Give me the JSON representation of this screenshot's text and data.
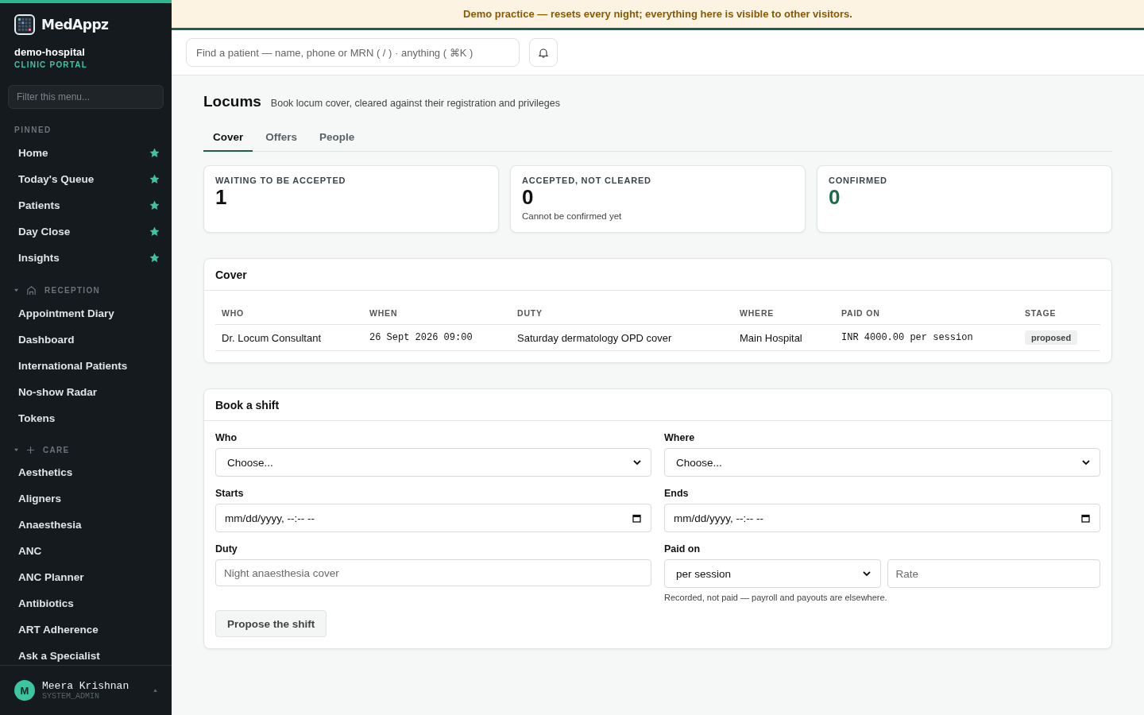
{
  "sidebar": {
    "brand": "MedAppz",
    "org": "demo-hospital",
    "portal": "CLINIC PORTAL",
    "filter": {
      "placeholder": "Filter this menu..."
    },
    "pinned": {
      "title": "PINNED",
      "items": [
        {
          "label": "Home",
          "starred": true
        },
        {
          "label": "Today's Queue",
          "starred": true
        },
        {
          "label": "Patients",
          "starred": true
        },
        {
          "label": "Day Close",
          "starred": true
        },
        {
          "label": "Insights",
          "starred": true
        }
      ]
    },
    "groups": [
      {
        "title": "RECEPTION",
        "kind": "house",
        "expanded": true,
        "items": [
          "Appointment Diary",
          "Dashboard",
          "International Patients",
          "No-show Radar",
          "Tokens"
        ]
      },
      {
        "title": "CARE",
        "kind": "plus",
        "expanded": true,
        "items": [
          "Aesthetics",
          "Aligners",
          "Anaesthesia",
          "ANC",
          "ANC Planner",
          "Antibiotics",
          "ART Adherence",
          "Ask a Specialist"
        ]
      }
    ],
    "user": {
      "initial": "M",
      "name": "Meera Krishnan",
      "role": "SYSTEM_ADMIN"
    }
  },
  "banner": "Demo practice — resets every night; everything here is visible to other visitors.",
  "search": {
    "placeholder": "Find a patient — name, phone or MRN ( / ) · anything ( ⌘K )"
  },
  "page": {
    "title": "Locums",
    "subtitle": "Book locum cover, cleared against their registration and privileges"
  },
  "tabs": [
    {
      "label": "Cover",
      "selected": true
    },
    {
      "label": "Offers",
      "selected": false
    },
    {
      "label": "People",
      "selected": false
    }
  ],
  "stats": [
    {
      "label": "WAITING TO BE ACCEPTED",
      "value": "1",
      "kind": "neutral"
    },
    {
      "label": "ACCEPTED, NOT CLEARED",
      "value": "0",
      "note": "Cannot be confirmed yet",
      "kind": "neutral"
    },
    {
      "label": "CONFIRMED",
      "value": "0",
      "kind": "positive"
    }
  ],
  "cover": {
    "title": "Cover",
    "columns": [
      "WHO",
      "WHEN",
      "DUTY",
      "WHERE",
      "PAID ON",
      "STAGE"
    ],
    "rows": [
      {
        "who": "Dr. Locum Consultant",
        "when": "26 Sept 2026 09:00",
        "duty": "Saturday dermatology OPD cover",
        "where": "Main Hospital",
        "paid": "INR 4000.00 per session",
        "stage": "proposed"
      }
    ]
  },
  "form": {
    "title": "Book a shift",
    "fields": [
      {
        "label": "Who",
        "kind": "select",
        "value": "Choose..."
      },
      {
        "label": "Where",
        "kind": "select",
        "value": "Choose..."
      },
      {
        "label": "Starts",
        "kind": "date",
        "value": "mm/dd/yyyy, --:-- --"
      },
      {
        "label": "Ends",
        "kind": "date",
        "value": "mm/dd/yyyy, --:-- --"
      },
      {
        "label": "Duty",
        "kind": "text",
        "placeholder": "Night anaesthesia cover"
      },
      {
        "label": "Paid on",
        "kind": "pair",
        "value": "per session",
        "placeholder": "Rate",
        "hint": "Recorded, not paid — payroll and payouts are elsewhere."
      }
    ],
    "submit": "Propose the shift"
  }
}
